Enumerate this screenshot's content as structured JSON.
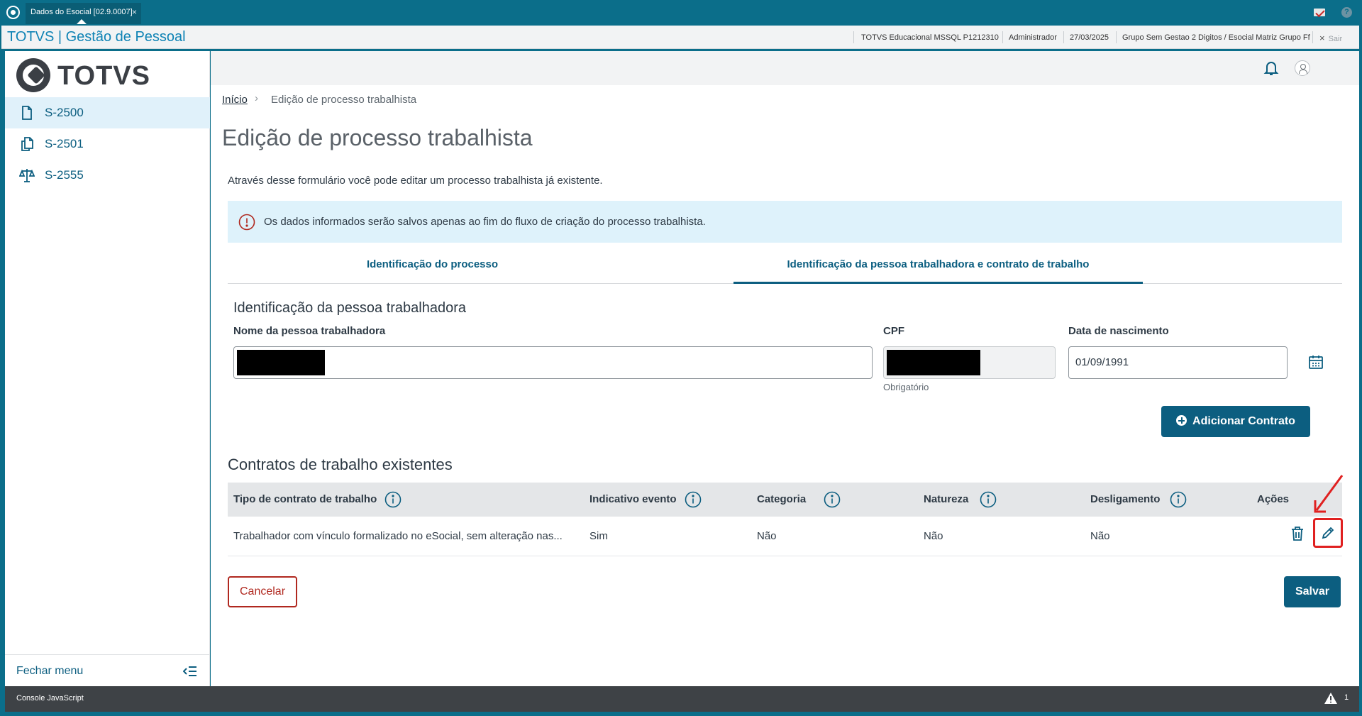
{
  "window": {
    "tab_title": "Dados do Esocial [02.9.0007]",
    "tab_close": "×",
    "help": "?"
  },
  "header": {
    "app_title": "TOTVS | Gestão de Pessoal",
    "database": "TOTVS Educacional MSSQL P1212310",
    "user": "Administrador",
    "date": "27/03/2025",
    "company": "Grupo Sem Gestao 2 Digitos / Esocial Matriz Grupo Ff",
    "logout_icon": "×",
    "logout_label": "Sair"
  },
  "sidebar": {
    "brand": "TOTVS",
    "items": [
      {
        "label": "S-2500",
        "icon": "document-icon",
        "active": true
      },
      {
        "label": "S-2501",
        "icon": "documents-icon",
        "active": false
      },
      {
        "label": "S-2555",
        "icon": "scale-icon",
        "active": false
      }
    ],
    "close_menu": "Fechar menu"
  },
  "breadcrumb": {
    "home": "Início",
    "separator": "›",
    "current": "Edição de processo trabalhista"
  },
  "page": {
    "title": "Edição de processo trabalhista",
    "intro": "Através desse formulário você pode editar um processo trabalhista já existente.",
    "notice": "Os dados informados serão salvos apenas ao fim do fluxo de criação do processo trabalhista."
  },
  "tabs": [
    {
      "label": "Identificação do processo",
      "active": false
    },
    {
      "label": "Identificação da pessoa trabalhadora e contrato de trabalho",
      "active": true
    }
  ],
  "worker": {
    "section_title": "Identificação da pessoa trabalhadora",
    "name_label": "Nome da pessoa trabalhadora",
    "name_value": "",
    "cpf_label": "CPF",
    "cpf_value": "",
    "cpf_helper": "Obrigatório",
    "birth_label": "Data de nascimento",
    "birth_value": "01/09/1991"
  },
  "contracts": {
    "add_button": "Adicionar Contrato",
    "section_title": "Contratos de trabalho existentes",
    "columns": [
      "Tipo de contrato de trabalho",
      "Indicativo evento",
      "Categoria",
      "Natureza",
      "Desligamento",
      "Ações"
    ],
    "rows": [
      [
        "Trabalhador com vínculo formalizado no eSocial, sem alteração nas...",
        "Sim",
        "Não",
        "Não",
        "Não"
      ]
    ]
  },
  "actions": {
    "cancel": "Cancelar",
    "save": "Salvar"
  },
  "console": {
    "label": "Console JavaScript",
    "warning_count": "1"
  },
  "colors": {
    "primary": "#0c5e80",
    "window_bar": "#0b6e8a",
    "cancel": "#b0281f",
    "notice_bg": "#def2fb",
    "highlight": "#e02020"
  }
}
